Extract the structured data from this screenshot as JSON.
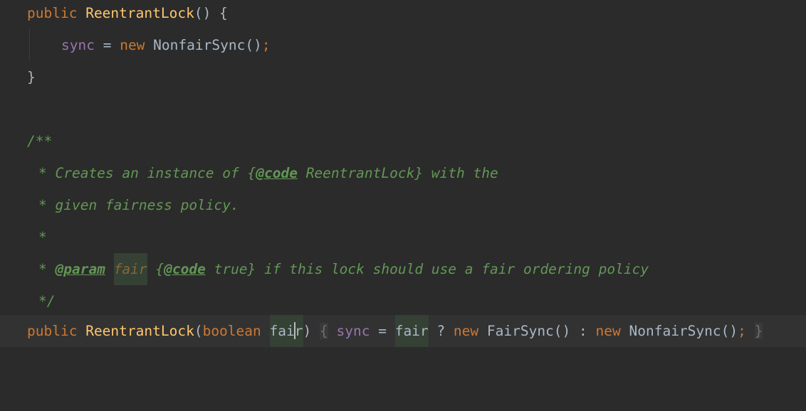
{
  "lines": {
    "l1": {
      "kw": "public",
      "name": "ReentrantLock",
      "rest": "() {"
    },
    "l2": {
      "field": "sync",
      "eq": " = ",
      "kw": "new",
      "cls": " NonfairSync()",
      "semi": ";"
    },
    "l3": {
      "brace": "}"
    },
    "doc": {
      "open": "/**",
      "line1_a": "* Creates an instance of {",
      "line1_tag": "@code",
      "line1_b": " ReentrantLock} with the",
      "line2": "* given fairness policy.",
      "line3": "*",
      "line4_a": "* ",
      "line4_tag": "@param",
      "line4_sp": " ",
      "line4_param": "fair",
      "line4_b": " {",
      "line4_tag2": "@code",
      "line4_c": " true} if this lock should use a fair ordering policy",
      "close": "*/"
    },
    "l10": {
      "kw1": "public",
      "name": "ReentrantLock",
      "open": "(",
      "kw2": "boolean",
      "param_a": "fai",
      "param_b": "r",
      "close": ")",
      "fold_open": "{",
      "field": "sync",
      "eq": " = ",
      "fair": "fair",
      "q": " ? ",
      "kw3": "new",
      "fs": " FairSync() : ",
      "kw4": "new",
      "nfs": " NonfairSync()",
      "semi": ";",
      "fold_close": "}"
    }
  }
}
